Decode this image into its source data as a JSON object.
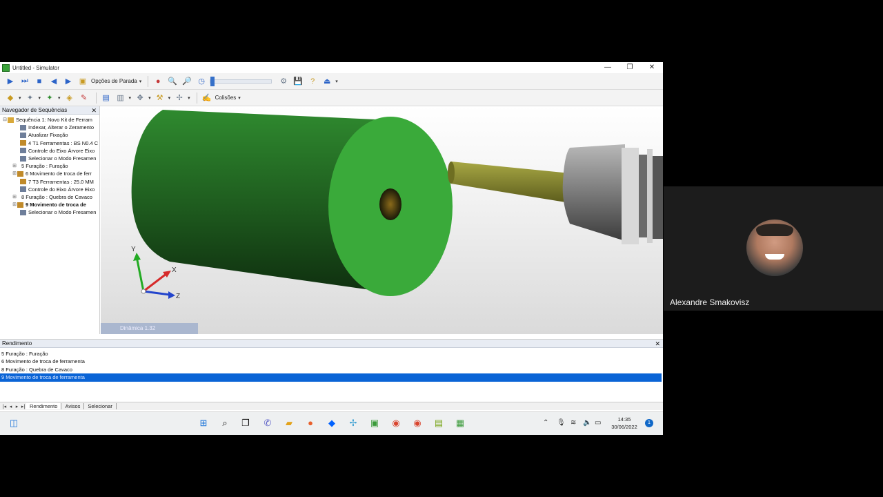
{
  "window": {
    "title": "Untitled - Simulator",
    "minimize": "—",
    "maximize": "❐",
    "close": "✕"
  },
  "toolbar1": {
    "stop_options_label": "Opções de Parada"
  },
  "toolbar2": {
    "collisions_label": "Colisões"
  },
  "navigator": {
    "title": "Navegador de Sequências",
    "close": "✕",
    "items": [
      {
        "label": "Sequência 1: Novo Kit de Ferram",
        "expander": "⊟"
      },
      {
        "label": "Indexar, Alterar o Zeramento"
      },
      {
        "label": "Atualizar Fixação"
      },
      {
        "label": "4 T1 Ferramentas : BS N0.4 C"
      },
      {
        "label": "Controle do Eixo Árvore Eixo"
      },
      {
        "label": "Selecionar o Modo Fresamen"
      },
      {
        "label": "5 Furação : Furação",
        "expander": "⊞"
      },
      {
        "label": "6 Movimento de troca de ferr",
        "expander": "⊞"
      },
      {
        "label": "7 T3 Ferramentas : 25.0 MM"
      },
      {
        "label": "Controle do Eixo Árvore Eixo"
      },
      {
        "label": "8 Furação : Quebra de Cavaco",
        "expander": "⊞"
      },
      {
        "label": "9 Movimento de troca de",
        "expander": "⊞",
        "bold": true
      },
      {
        "label": "Selecionar o Modo Fresamen"
      }
    ]
  },
  "viewport": {
    "axis_y": "Y",
    "axis_x": "X",
    "axis_z": "Z",
    "dynamics_label": "Dinâmica 1.32",
    "colors": {
      "workpiece": "#3aaa3a",
      "workpiece_side": "#1f5e1f",
      "tool_shank": "#8a8a2a",
      "spindle": "#8e8e8e"
    }
  },
  "output": {
    "title": "Rendimento",
    "close": "✕",
    "lines": [
      "5 Furação : Furação",
      "6 Movimento de troca de ferramenta",
      "8 Furação : Quebra de Cavaco",
      "9 Movimento de troca de ferramenta"
    ],
    "selected_index": 3
  },
  "tabs": [
    {
      "label": "Rendimento",
      "active": true
    },
    {
      "label": "Avisos"
    },
    {
      "label": "Selecionar"
    }
  ],
  "taskbar": {
    "time": "14:35",
    "date": "30/06/2022",
    "notifications": "1"
  },
  "participant": {
    "name": "Alexandre Smakovisz"
  }
}
